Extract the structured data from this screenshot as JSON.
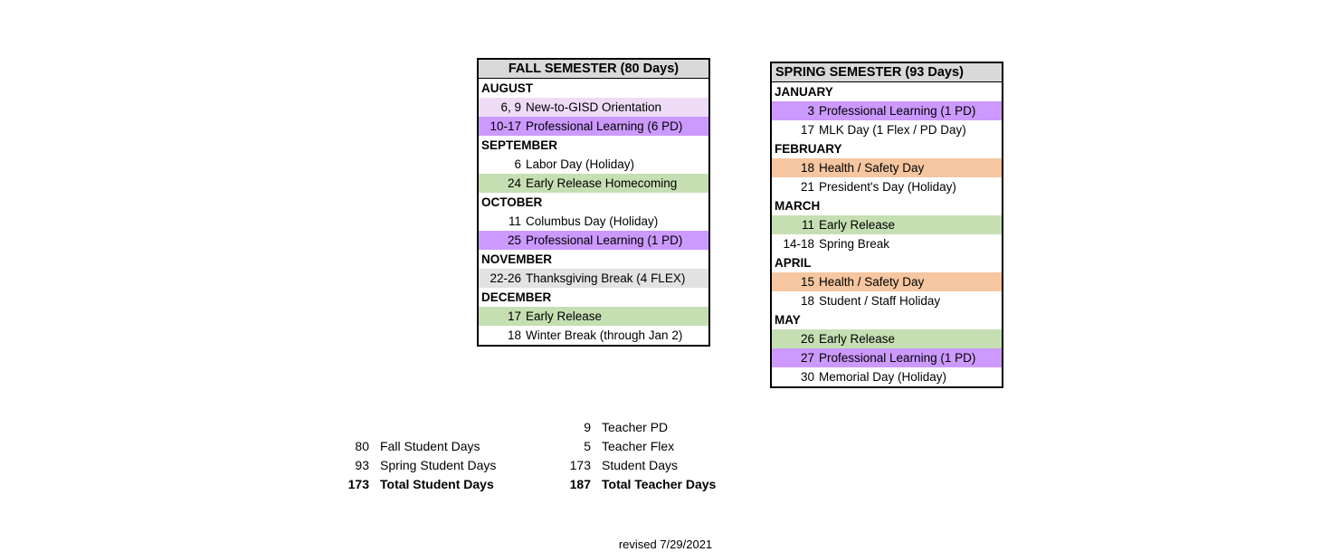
{
  "fall": {
    "header": "FALL SEMESTER (80 Days)",
    "rows": [
      {
        "kind": "month",
        "label": "AUGUST",
        "fill": "none"
      },
      {
        "kind": "event",
        "date": "6, 9",
        "label": "New-to-GISD Orientation",
        "fill": "lavender"
      },
      {
        "kind": "event",
        "date": "10-17",
        "label": "Professional Learning (6 PD)",
        "fill": "purple"
      },
      {
        "kind": "month",
        "label": "SEPTEMBER",
        "fill": "none"
      },
      {
        "kind": "event",
        "date": "6",
        "label": "Labor Day (Holiday)",
        "fill": "none"
      },
      {
        "kind": "event",
        "date": "24",
        "label": "Early Release Homecoming",
        "fill": "green"
      },
      {
        "kind": "month",
        "label": "OCTOBER",
        "fill": "none"
      },
      {
        "kind": "event",
        "date": "11",
        "label": "Columbus Day (Holiday)",
        "fill": "none"
      },
      {
        "kind": "event",
        "date": "25",
        "label": "Professional Learning (1 PD)",
        "fill": "purple"
      },
      {
        "kind": "month",
        "label": "NOVEMBER",
        "fill": "none"
      },
      {
        "kind": "event",
        "date": "22-26",
        "label": "Thanksgiving Break (4 FLEX)",
        "fill": "gray"
      },
      {
        "kind": "month",
        "label": "DECEMBER",
        "fill": "none"
      },
      {
        "kind": "event",
        "date": "17",
        "label": "Early Release",
        "fill": "green"
      },
      {
        "kind": "event",
        "date": "18",
        "label": "Winter Break (through Jan 2)",
        "fill": "none"
      }
    ]
  },
  "spring": {
    "header": "SPRING SEMESTER (93 Days)",
    "rows": [
      {
        "kind": "month",
        "label": "JANUARY",
        "fill": "none"
      },
      {
        "kind": "event",
        "date": "3",
        "label": "Professional Learning (1 PD)",
        "fill": "purple"
      },
      {
        "kind": "event",
        "date": "17",
        "label": "MLK Day (1 Flex / PD Day)",
        "fill": "none"
      },
      {
        "kind": "month",
        "label": "FEBRUARY",
        "fill": "none"
      },
      {
        "kind": "event",
        "date": "18",
        "label": "Health / Safety Day",
        "fill": "orange"
      },
      {
        "kind": "event",
        "date": "21",
        "label": "President's Day (Holiday)",
        "fill": "none"
      },
      {
        "kind": "month",
        "label": "MARCH",
        "fill": "none"
      },
      {
        "kind": "event",
        "date": "11",
        "label": "Early Release",
        "fill": "green"
      },
      {
        "kind": "event",
        "date": "14-18",
        "label": "Spring Break",
        "fill": "none"
      },
      {
        "kind": "month",
        "label": "APRIL",
        "fill": "none"
      },
      {
        "kind": "event",
        "date": "15",
        "label": "Health / Safety Day",
        "fill": "orange"
      },
      {
        "kind": "event",
        "date": "18",
        "label": "Student / Staff Holiday",
        "fill": "none"
      },
      {
        "kind": "month",
        "label": "MAY",
        "fill": "none"
      },
      {
        "kind": "event",
        "date": "26",
        "label": "Early Release",
        "fill": "green"
      },
      {
        "kind": "event",
        "date": "27",
        "label": "Professional Learning (1 PD)",
        "fill": "purple"
      },
      {
        "kind": "event",
        "date": "30",
        "label": "Memorial Day (Holiday)",
        "fill": "none"
      }
    ]
  },
  "summary": {
    "left": [
      {
        "spacer": true
      },
      {
        "num": "80",
        "label": "Fall Student Days",
        "bold": false
      },
      {
        "num": "93",
        "label": "Spring Student Days",
        "bold": false
      },
      {
        "num": "173",
        "label": "Total Student Days",
        "bold": true
      }
    ],
    "right": [
      {
        "num": "9",
        "label": "Teacher PD",
        "bold": false
      },
      {
        "num": "5",
        "label": "Teacher Flex",
        "bold": false
      },
      {
        "num": "173",
        "label": "Student Days",
        "bold": false
      },
      {
        "num": "187",
        "label": "Total Teacher Days",
        "bold": true
      }
    ]
  },
  "footer": {
    "revised": "revised 7/29/2021"
  },
  "colors": {
    "header_gray": "#d9d9d9",
    "purple": "#cc99ff",
    "lavender": "#eedcf7",
    "green": "#c5dfb3",
    "orange": "#f5c6a0",
    "gray": "#e2e2e2",
    "border": "#000000",
    "text": "#000000"
  }
}
